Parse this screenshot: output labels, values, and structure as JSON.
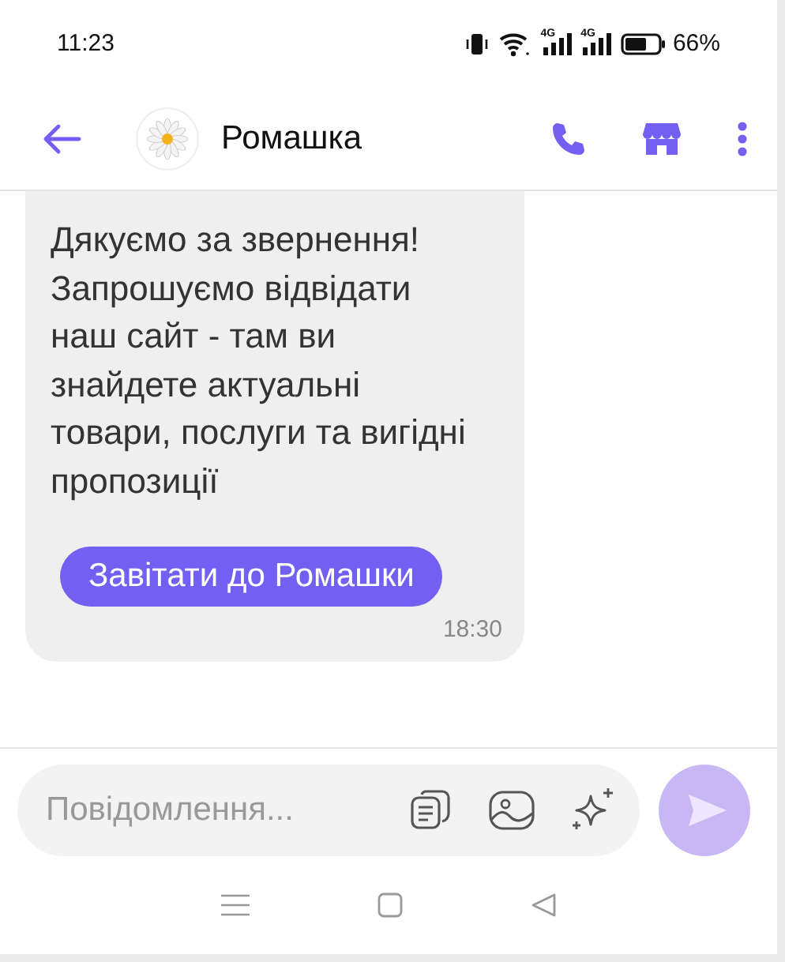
{
  "status_bar": {
    "time": "11:23",
    "signals": [
      {
        "label": "4G"
      },
      {
        "label": "4G"
      }
    ],
    "battery": "66%"
  },
  "header": {
    "title": "Ромашка"
  },
  "messages": [
    {
      "kind": "incoming",
      "text": "Дякуємо за звернення! Запрошуємо відвідати наш сайт - там ви знайдете актуальні товари, послуги та вигідні пропозиції",
      "button": "Завітати до Ромашки",
      "time": "18:30"
    }
  ],
  "composer": {
    "placeholder": "Повідомлення..."
  }
}
